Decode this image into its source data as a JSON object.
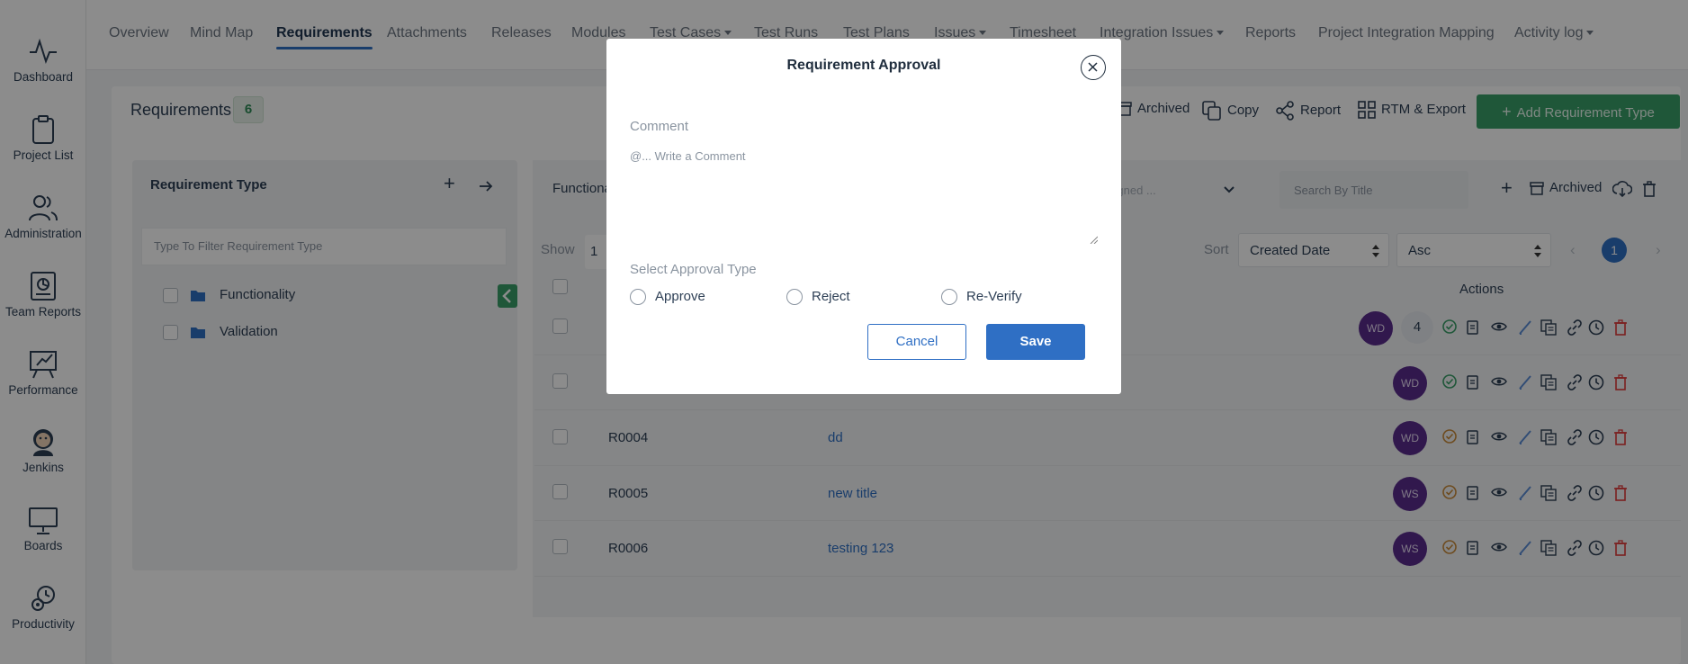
{
  "sidebar": {
    "items": [
      {
        "label": "Dashboard",
        "icon": "activity-icon"
      },
      {
        "label": "Project List",
        "icon": "clipboard-icon"
      },
      {
        "label": "Administration",
        "icon": "users-icon"
      },
      {
        "label": "Team Reports",
        "icon": "report-icon"
      },
      {
        "label": "Performance",
        "icon": "easel-icon"
      },
      {
        "label": "Jenkins",
        "icon": "jenkins-icon"
      },
      {
        "label": "Boards",
        "icon": "presentation-icon"
      },
      {
        "label": "Productivity",
        "icon": "gear-icon"
      }
    ]
  },
  "tabs": [
    {
      "label": "Overview"
    },
    {
      "label": "Mind Map"
    },
    {
      "label": "Requirements",
      "active": true
    },
    {
      "label": "Attachments"
    },
    {
      "label": "Releases"
    },
    {
      "label": "Modules"
    },
    {
      "label": "Test Cases",
      "dropdown": true
    },
    {
      "label": "Test Runs"
    },
    {
      "label": "Test Plans"
    },
    {
      "label": "Issues",
      "dropdown": true
    },
    {
      "label": "Timesheet"
    },
    {
      "label": "Integration Issues",
      "dropdown": true
    },
    {
      "label": "Reports"
    },
    {
      "label": "Project Integration Mapping"
    },
    {
      "label": "Activity log",
      "dropdown": true
    }
  ],
  "page": {
    "title": "Requirements",
    "count": "6",
    "actions": {
      "archived": "Archived",
      "copy": "Copy",
      "report": "Report",
      "rtm_export": "RTM & Export",
      "add_type": "Add Requirement Type"
    }
  },
  "left_panel": {
    "title": "Requirement Type",
    "filter_placeholder": "Type To Filter Requirement Type",
    "tree": [
      {
        "label": "Functionality"
      },
      {
        "label": "Validation"
      }
    ]
  },
  "right_panel": {
    "tab_label": "Functiona",
    "assigned_placeholder": "signed ...",
    "search_placeholder": "Search By Title",
    "archived_label": "Archived",
    "show_label": "Show",
    "show_value": "1",
    "sort_label": "Sort",
    "sort_field": "Created Date",
    "sort_order": "Asc",
    "page_number": "1",
    "actions_header": "Actions"
  },
  "table": {
    "rows": [
      {
        "id": "",
        "title": "",
        "avatar": "WD",
        "comment_count": "4",
        "status": "approved"
      },
      {
        "id": "",
        "title": "",
        "avatar": "WD",
        "status": "approved"
      },
      {
        "id": "R0004",
        "title": "dd",
        "avatar": "WD",
        "status": "pending"
      },
      {
        "id": "R0005",
        "title": "new title",
        "avatar": "WS",
        "status": "pending"
      },
      {
        "id": "R0006",
        "title": "testing 123",
        "avatar": "WS",
        "status": "pending"
      }
    ]
  },
  "modal": {
    "title": "Requirement Approval",
    "comment_label": "Comment",
    "comment_placeholder": "@... Write a Comment",
    "approval_label": "Select Approval Type",
    "options": [
      "Approve",
      "Reject",
      "Re-Verify"
    ],
    "cancel_label": "Cancel",
    "save_label": "Save"
  },
  "colors": {
    "accent_blue": "#2f6fc4",
    "accent_green": "#3a9e68",
    "avatar_purple": "#5a2d8c",
    "delete_red": "#e03b3b"
  }
}
